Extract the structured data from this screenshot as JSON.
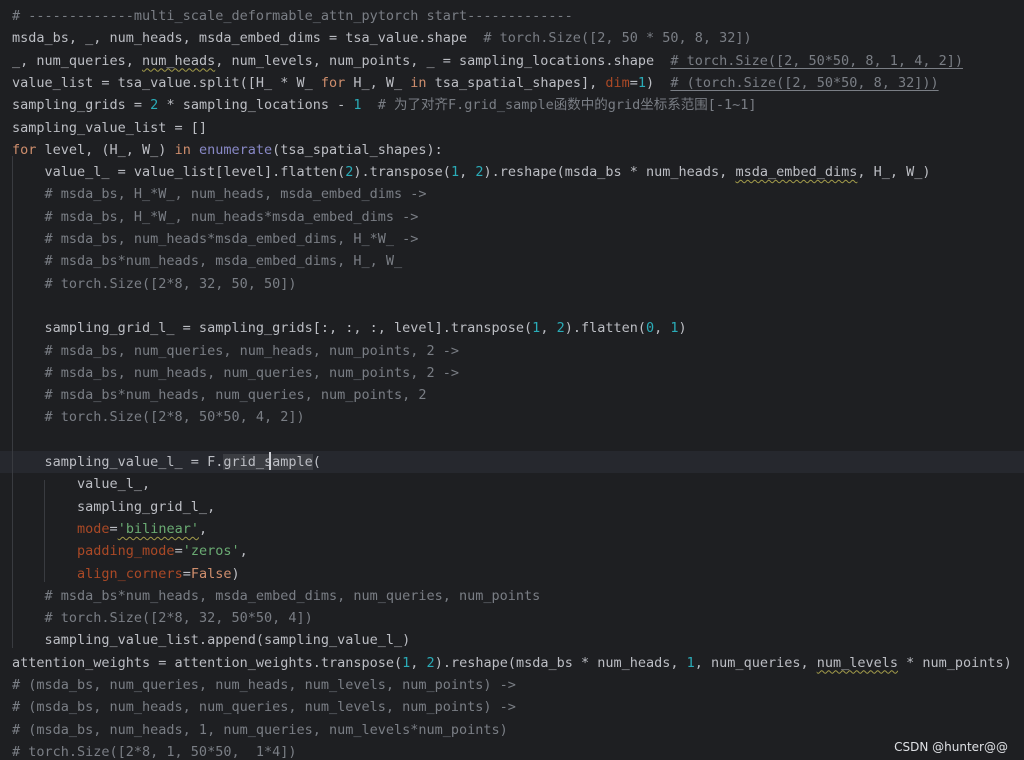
{
  "watermark": "CSDN @hunter@@",
  "lines": [
    [
      [
        "c",
        "# -------------multi_scale_deformable_attn_pytorch start-------------"
      ]
    ],
    [
      [
        "t",
        "msda_bs, _, num_heads, msda_embed_dims = tsa_value.shape  "
      ],
      [
        "c",
        "# torch.Size([2, 50 * 50, 8, 32])"
      ]
    ],
    [
      [
        "t",
        "_, num_queries, "
      ],
      [
        "t wavy",
        "num_heads"
      ],
      [
        "t",
        ", num_levels, num_points, _ = sampling_locations.shape  "
      ],
      [
        "lc",
        "# torch.Size([2, 50*50, 8, 1, 4, 2])"
      ]
    ],
    [
      [
        "t",
        "value_list = tsa_value.split([H_ * W_ "
      ],
      [
        "k",
        "for"
      ],
      [
        "t",
        " H_, W_ "
      ],
      [
        "k",
        "in"
      ],
      [
        "t",
        " tsa_spatial_shapes], "
      ],
      [
        "p",
        "dim"
      ],
      [
        "t",
        "="
      ],
      [
        "n",
        "1"
      ],
      [
        "t",
        ")  "
      ],
      [
        "lc",
        "# (torch.Size([2, 50*50, 8, 32]))"
      ]
    ],
    [
      [
        "t",
        "sampling_grids = "
      ],
      [
        "n",
        "2"
      ],
      [
        "t",
        " * sampling_locations - "
      ],
      [
        "n",
        "1"
      ],
      [
        "t",
        "  "
      ],
      [
        "c",
        "# 为了对齐F.grid_sample函数中的grid坐标系范围[-1~1]"
      ]
    ],
    [
      [
        "t",
        "sampling_value_list = []"
      ]
    ],
    [
      [
        "k",
        "for"
      ],
      [
        "t",
        " level, (H_, W_) "
      ],
      [
        "k",
        "in"
      ],
      [
        "t",
        " "
      ],
      [
        "b",
        "enumerate"
      ],
      [
        "t",
        "(tsa_spatial_shapes):"
      ]
    ],
    [
      [
        "t",
        "    value_l_ = value_list[level].flatten("
      ],
      [
        "n",
        "2"
      ],
      [
        "t",
        ").transpose("
      ],
      [
        "n",
        "1"
      ],
      [
        "t",
        ", "
      ],
      [
        "n",
        "2"
      ],
      [
        "t",
        ").reshape(msda_bs * num_heads, "
      ],
      [
        "t wavy",
        "msda_embed_dims"
      ],
      [
        "t",
        ", H_, W_)"
      ]
    ],
    [
      [
        "t",
        "    "
      ],
      [
        "c",
        "# msda_bs, H_*W_, num_heads, msda_embed_dims ->"
      ]
    ],
    [
      [
        "t",
        "    "
      ],
      [
        "c",
        "# msda_bs, H_*W_, num_heads*msda_embed_dims ->"
      ]
    ],
    [
      [
        "t",
        "    "
      ],
      [
        "c",
        "# msda_bs, num_heads*msda_embed_dims, H_*W_ ->"
      ]
    ],
    [
      [
        "t",
        "    "
      ],
      [
        "c",
        "# msda_bs*num_heads, msda_embed_dims, H_, W_"
      ]
    ],
    [
      [
        "t",
        "    "
      ],
      [
        "c",
        "# torch.Size([2*8, 32, 50, 50])"
      ]
    ],
    [],
    [
      [
        "t",
        "    sampling_grid_l_ = sampling_grids[:, :, :, level].transpose("
      ],
      [
        "n",
        "1"
      ],
      [
        "t",
        ", "
      ],
      [
        "n",
        "2"
      ],
      [
        "t",
        ").flatten("
      ],
      [
        "n",
        "0"
      ],
      [
        "t",
        ", "
      ],
      [
        "n",
        "1"
      ],
      [
        "t",
        ")"
      ]
    ],
    [
      [
        "t",
        "    "
      ],
      [
        "c",
        "# msda_bs, num_queries, num_heads, num_points, 2 ->"
      ]
    ],
    [
      [
        "t",
        "    "
      ],
      [
        "c",
        "# msda_bs, num_heads, num_queries, num_points, 2 ->"
      ]
    ],
    [
      [
        "t",
        "    "
      ],
      [
        "c",
        "# msda_bs*num_heads, num_queries, num_points, 2"
      ]
    ],
    [
      [
        "t",
        "    "
      ],
      [
        "c",
        "# torch.Size([2*8, 50*50, 4, 2])"
      ]
    ],
    [],
    [
      [
        "t",
        "    sampling_value_l_ = F."
      ],
      [
        "t hl",
        "grid_sample"
      ],
      [
        "t",
        "("
      ]
    ],
    [
      [
        "t",
        "        value_l_,"
      ]
    ],
    [
      [
        "t",
        "        sampling_grid_l_,"
      ]
    ],
    [
      [
        "t",
        "        "
      ],
      [
        "p",
        "mode"
      ],
      [
        "t",
        "="
      ],
      [
        "s wavy",
        "'bilinear'"
      ],
      [
        "t",
        ","
      ]
    ],
    [
      [
        "t",
        "        "
      ],
      [
        "p",
        "padding_mode"
      ],
      [
        "t",
        "="
      ],
      [
        "s",
        "'zeros'"
      ],
      [
        "t",
        ","
      ]
    ],
    [
      [
        "t",
        "        "
      ],
      [
        "p",
        "align_corners"
      ],
      [
        "t",
        "="
      ],
      [
        "k",
        "False"
      ],
      [
        "t",
        ")"
      ]
    ],
    [
      [
        "t",
        "    "
      ],
      [
        "c",
        "# msda_bs*num_heads, msda_embed_dims, num_queries, num_points"
      ]
    ],
    [
      [
        "t",
        "    "
      ],
      [
        "c",
        "# torch.Size([2*8, 32, 50*50, 4])"
      ]
    ],
    [
      [
        "t",
        "    sampling_value_list.append(sampling_value_l_)"
      ]
    ],
    [
      [
        "t",
        "attention_weights = attention_weights.transpose("
      ],
      [
        "n",
        "1"
      ],
      [
        "t",
        ", "
      ],
      [
        "n",
        "2"
      ],
      [
        "t",
        ").reshape(msda_bs * num_heads, "
      ],
      [
        "n",
        "1"
      ],
      [
        "t",
        ", num_queries, "
      ],
      [
        "t wavy",
        "num_levels"
      ],
      [
        "t",
        " * num_points)"
      ]
    ],
    [
      [
        "c",
        "# (msda_bs, num_queries, num_heads, num_levels, num_points) ->"
      ]
    ],
    [
      [
        "c",
        "# (msda_bs, num_heads, num_queries, num_levels, num_points) ->"
      ]
    ],
    [
      [
        "c",
        "# (msda_bs, num_heads, 1, num_queries, num_levels*num_points)"
      ]
    ],
    [
      [
        "c",
        "# torch.Size([2*8, 1, 50*50,  1*4])"
      ]
    ]
  ]
}
